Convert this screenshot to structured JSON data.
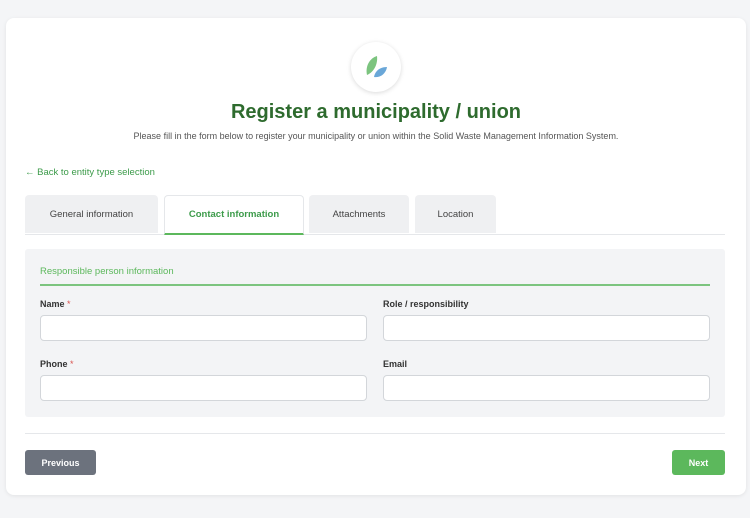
{
  "header": {
    "logo_icon": "leaf-icon",
    "title": "Register a municipality / union",
    "subtitle": "Please fill in the form below to register your municipality or union within the Solid Waste Management Information System."
  },
  "back_link": "← Back to entity type selection",
  "tabs": [
    {
      "label": "General information",
      "active": false
    },
    {
      "label": "Contact information",
      "active": true
    },
    {
      "label": "Attachments",
      "active": false
    },
    {
      "label": "Location",
      "active": false
    }
  ],
  "section": {
    "title": "Responsible person information"
  },
  "fields": {
    "name": {
      "label": "Name",
      "required": "*",
      "value": ""
    },
    "role": {
      "label": "Role / responsibility",
      "value": ""
    },
    "phone": {
      "label": "Phone",
      "required": "*",
      "value": ""
    },
    "email": {
      "label": "Email",
      "value": ""
    }
  },
  "buttons": {
    "previous": "Previous",
    "next": "Next"
  },
  "colors": {
    "brand_green": "#2e6b2e",
    "accent_green": "#5cb85c",
    "secondary_gray": "#6c727d",
    "required_red": "#d9534f"
  }
}
